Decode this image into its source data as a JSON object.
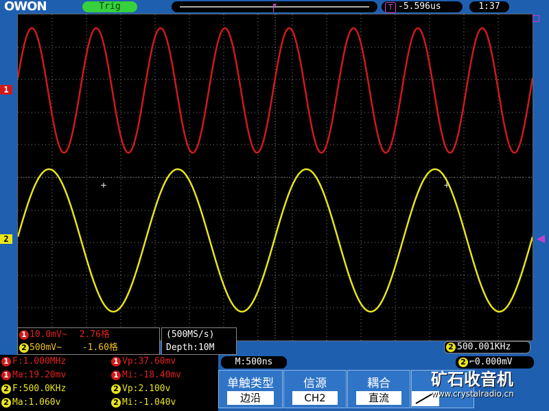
{
  "header": {
    "logo": "OWON",
    "trig_status": "Trig",
    "trigger_time": "-5.596us",
    "trigger_time_icon": "T",
    "clock": "1:37"
  },
  "markers": {
    "ch1": "1",
    "ch2": "2"
  },
  "channel_settings": {
    "ch1": {
      "badge": "1",
      "scale": "10.0mV~",
      "offset": "2.76格"
    },
    "ch2": {
      "badge": "2",
      "scale": "500mV~",
      "offset": "-1.60格"
    }
  },
  "acquisition": {
    "sample_rate": "(500MS/s)",
    "depth": "Depth:10M"
  },
  "trigger_freq": {
    "badge": "2",
    "value": "500.001KHz"
  },
  "measurements": [
    {
      "badge": "1",
      "label": "F:1.000MHz"
    },
    {
      "badge": "1",
      "label": "Vp:37.60mv"
    },
    {
      "badge": "1",
      "label": "Ma:19.20mv"
    },
    {
      "badge": "1",
      "label": "Mi:-18.40mv"
    },
    {
      "badge": "2",
      "label": "F:500.0KHz"
    },
    {
      "badge": "2",
      "label": "Vp:2.100v"
    },
    {
      "badge": "2",
      "label": "Ma:1.060v"
    },
    {
      "badge": "2",
      "label": "Mi:-1.040v"
    }
  ],
  "timebase": "M:500ns",
  "trigger_level": {
    "badge": "2",
    "value": "0.000mV"
  },
  "menu": [
    {
      "label": "单触类型",
      "value": "边沿"
    },
    {
      "label": "信源",
      "value": "CH2"
    },
    {
      "label": "耦合",
      "value": "直流"
    }
  ],
  "watermark": {
    "title": "矿石收音机",
    "url": "www.crystalradio.cn"
  },
  "colors": {
    "ch1": "#d01a1a",
    "ch2": "#e9e51b",
    "trigger": "#c040d0",
    "grid": "#8a8a8a"
  },
  "waveforms": {
    "ch1": {
      "cycles_on_screen": 8,
      "frequency": "1.000MHz"
    },
    "ch2": {
      "cycles_on_screen": 4,
      "frequency": "500.0KHz"
    }
  }
}
